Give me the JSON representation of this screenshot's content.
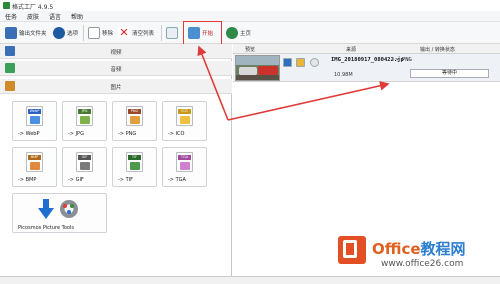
{
  "window": {
    "title": "格式工厂 4.9.5"
  },
  "menu": [
    "任务",
    "皮肤",
    "语言",
    "帮助"
  ],
  "toolbar": {
    "output_folder": "输出文件夹",
    "options": "选项",
    "remove": "移除",
    "clear_list": "清空列表",
    "start": "开始",
    "home": "主页"
  },
  "categories": {
    "video": "视频",
    "audio": "音频",
    "image": "图片"
  },
  "formats": [
    {
      "tag": "WebP",
      "label": "-> WebP",
      "color": "#2d5fbf",
      "pic": "#4a90e2"
    },
    {
      "tag": "JPG",
      "label": "-> JPG",
      "color": "#4a7a32",
      "pic": "#7fb24a"
    },
    {
      "tag": "PNG",
      "label": "-> PNG",
      "color": "#9a4a2a",
      "pic": "#e0a040"
    },
    {
      "tag": "ICO",
      "label": "-> ICO",
      "color": "#c99a1a",
      "pic": "#f0c040"
    },
    {
      "tag": "BMP",
      "label": "-> BMP",
      "color": "#b06a20",
      "pic": "#e08a40"
    },
    {
      "tag": "GIF",
      "label": "-> GIF",
      "color": "#555555",
      "pic": "#7a7a7a"
    },
    {
      "tag": "TIF",
      "label": "-> TIF",
      "color": "#2a6a2a",
      "pic": "#4c9a4c"
    },
    {
      "tag": "TGA",
      "label": "-> TGA",
      "color": "#a04aa0",
      "pic": "#d080d0"
    }
  ],
  "picosmos": {
    "label": "Picosmos Picture Tools"
  },
  "list_header": {
    "preview": "预览",
    "source": "来源",
    "output_status": "输出 / 转换状态"
  },
  "job": {
    "filename": "IMG_20180917_080422.jp",
    "arrow": "-> PNG",
    "size": "10.98M",
    "status": "等待中"
  },
  "watermark": {
    "brand_a": "Office",
    "brand_b": "教程网",
    "url": "www.office26.com"
  },
  "colors": {
    "accent_red": "#e03a3a",
    "brand_orange": "#e34f25",
    "brand_blue": "#2c7ed0"
  }
}
